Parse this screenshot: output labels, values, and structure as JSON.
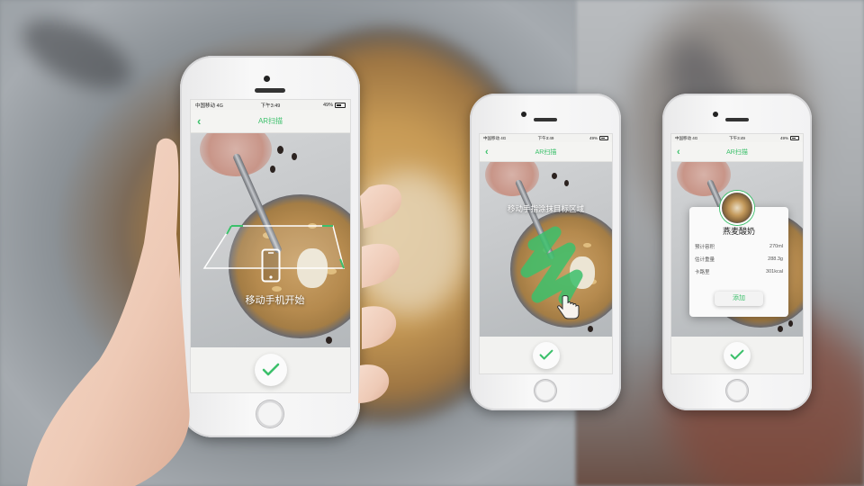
{
  "colors": {
    "accent": "#3cc06b",
    "screen_bg": "#f2f2f0"
  },
  "phones": [
    {
      "status": {
        "carrier": "中国移动 4G",
        "time": "下午3:49",
        "battery": "49%"
      },
      "nav": {
        "back_icon": "chevron-left-icon",
        "title": "AR扫描"
      },
      "overlay_text": "移动手机开始",
      "confirm_icon": "checkmark-icon"
    },
    {
      "status": {
        "carrier": "中国移动 4G",
        "time": "下午3:49",
        "battery": "49%"
      },
      "nav": {
        "back_icon": "chevron-left-icon",
        "title": "AR扫描"
      },
      "overlay_text": "移动手指涂抹目标区域",
      "confirm_icon": "checkmark-icon"
    },
    {
      "status": {
        "carrier": "中国移动 4G",
        "time": "下午3:49",
        "battery": "49%"
      },
      "nav": {
        "back_icon": "chevron-left-icon",
        "title": "AR扫描"
      },
      "popup": {
        "title": "燕麦酸奶",
        "rows": [
          {
            "label": "预计容积",
            "value": "270ml"
          },
          {
            "label": "估计重量",
            "value": "288.3g"
          },
          {
            "label": "卡路里",
            "value": "301kcal"
          }
        ],
        "add_label": "添加"
      },
      "confirm_icon": "checkmark-icon"
    }
  ]
}
